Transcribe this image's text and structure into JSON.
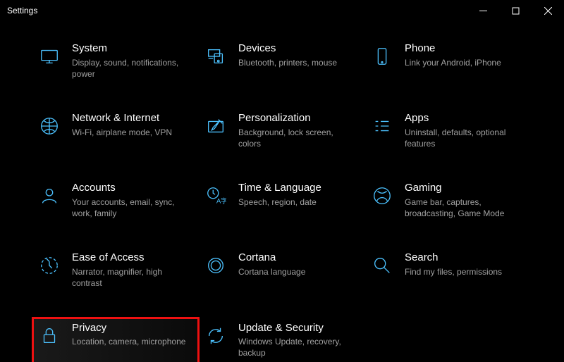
{
  "window": {
    "title": "Settings"
  },
  "tiles": [
    {
      "key": "system",
      "title": "System",
      "desc": "Display, sound, notifications, power"
    },
    {
      "key": "devices",
      "title": "Devices",
      "desc": "Bluetooth, printers, mouse"
    },
    {
      "key": "phone",
      "title": "Phone",
      "desc": "Link your Android, iPhone"
    },
    {
      "key": "network",
      "title": "Network & Internet",
      "desc": "Wi-Fi, airplane mode, VPN"
    },
    {
      "key": "personalization",
      "title": "Personalization",
      "desc": "Background, lock screen, colors"
    },
    {
      "key": "apps",
      "title": "Apps",
      "desc": "Uninstall, defaults, optional features"
    },
    {
      "key": "accounts",
      "title": "Accounts",
      "desc": "Your accounts, email, sync, work, family"
    },
    {
      "key": "time",
      "title": "Time & Language",
      "desc": "Speech, region, date"
    },
    {
      "key": "gaming",
      "title": "Gaming",
      "desc": "Game bar, captures, broadcasting, Game Mode"
    },
    {
      "key": "ease",
      "title": "Ease of Access",
      "desc": "Narrator, magnifier, high contrast"
    },
    {
      "key": "cortana",
      "title": "Cortana",
      "desc": "Cortana language"
    },
    {
      "key": "search",
      "title": "Search",
      "desc": "Find my files, permissions"
    },
    {
      "key": "privacy",
      "title": "Privacy",
      "desc": "Location, camera, microphone"
    },
    {
      "key": "update",
      "title": "Update & Security",
      "desc": "Windows Update, recovery, backup"
    }
  ],
  "highlight_key": "privacy"
}
